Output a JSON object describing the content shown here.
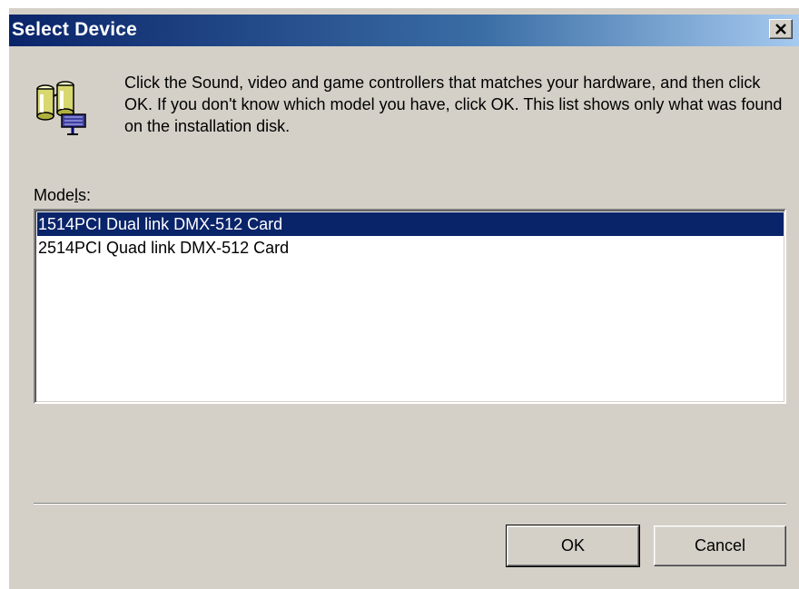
{
  "window": {
    "title": "Select Device",
    "close_icon": "close-icon"
  },
  "header": {
    "icon": "hardware-device-icon",
    "instructions": "Click the Sound, video and game controllers that matches your hardware, and then click OK. If you don't know which model you have, click OK. This list shows only what was found on the installation disk."
  },
  "models": {
    "label_before": "Mode",
    "label_accel": "l",
    "label_after": "s:",
    "items": [
      {
        "label": "1514PCI Dual link DMX-512 Card",
        "selected": true
      },
      {
        "label": "2514PCI Quad link DMX-512 Card",
        "selected": false
      }
    ]
  },
  "buttons": {
    "ok_label": "OK",
    "cancel_label": "Cancel"
  },
  "colors": {
    "titlebar_start": "#0a246a",
    "titlebar_end": "#a6caf0",
    "selection": "#0a246a",
    "face": "#d4d0c8"
  }
}
